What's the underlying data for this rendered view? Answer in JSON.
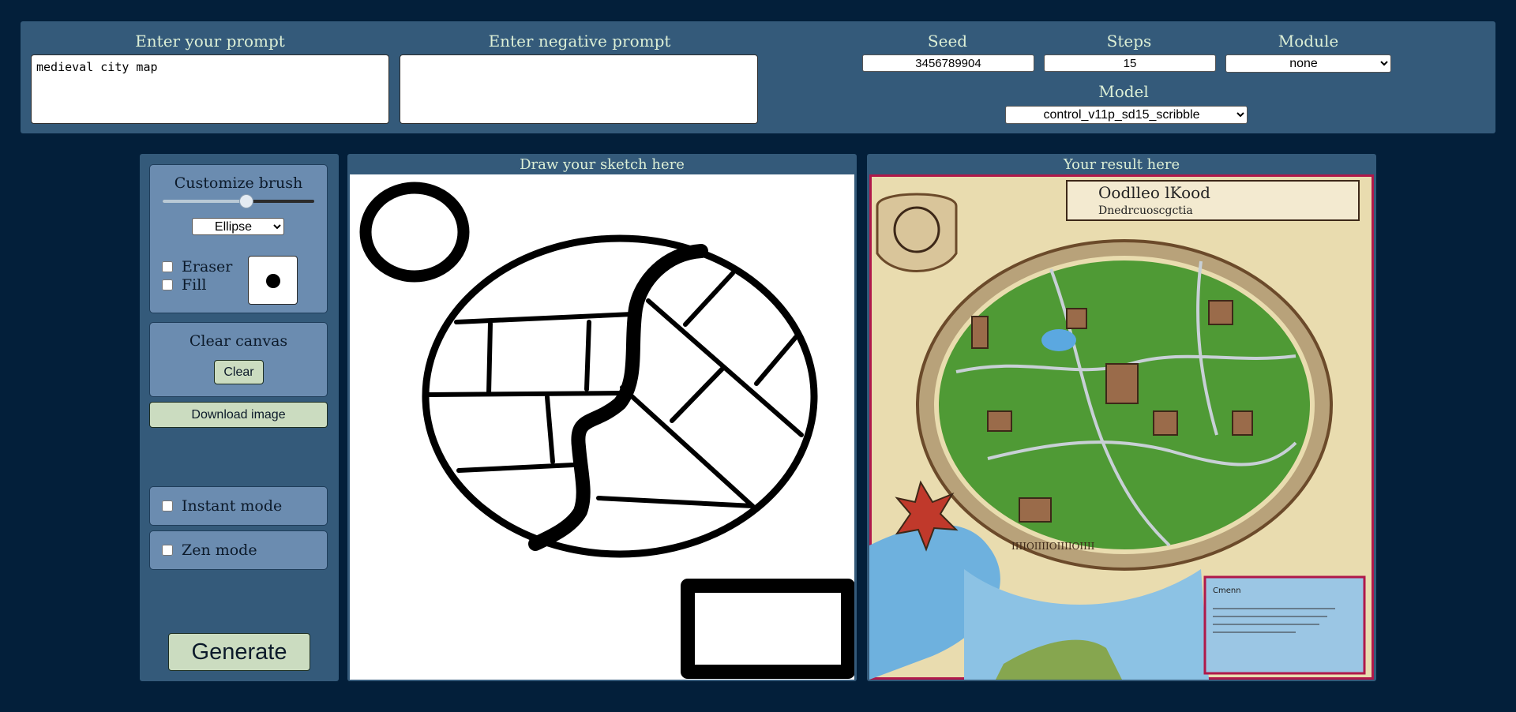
{
  "prompt": {
    "label": "Enter your prompt",
    "value": "medieval city map"
  },
  "negative_prompt": {
    "label": "Enter negative prompt",
    "value": ""
  },
  "seed": {
    "label": "Seed",
    "value": "3456789904"
  },
  "steps": {
    "label": "Steps",
    "value": "15"
  },
  "module": {
    "label": "Module",
    "selected": "none"
  },
  "model": {
    "label": "Model",
    "selected": "control_v11p_sd15_scribble"
  },
  "brush": {
    "label": "Customize brush",
    "size_fraction": 0.55,
    "shape": "Ellipse"
  },
  "eraser": {
    "label": "Eraser",
    "checked": false
  },
  "fill": {
    "label": "Fill",
    "checked": false
  },
  "clear_canvas": {
    "label": "Clear canvas",
    "button": "Clear"
  },
  "download": {
    "button": "Download image"
  },
  "instant_mode": {
    "label": "Instant mode",
    "checked": false
  },
  "zen_mode": {
    "label": "Zen mode",
    "checked": false
  },
  "generate": {
    "button": "Generate"
  },
  "sketch": {
    "label": "Draw your sketch here"
  },
  "result": {
    "label": "Your result here",
    "map_title": "Oodlleo lKood",
    "map_subtitle": "Dnedrcuoscgctia",
    "map_border_text": "IIIIOIIIIOIIIIOIIII",
    "map_legend_text": "Cmenn"
  },
  "colors": {
    "background": "#031f3a",
    "panel": "#345a7a",
    "box": "#6b8cb0",
    "button": "#cbdcc0",
    "label_text": "#dcefd6"
  }
}
